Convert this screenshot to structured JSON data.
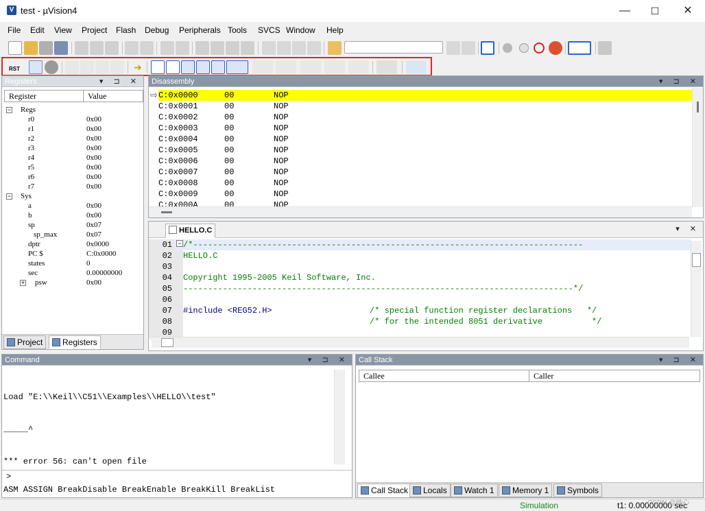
{
  "window": {
    "title": "test  - µVision4",
    "icon": "uv-icon"
  },
  "menu": [
    "File",
    "Edit",
    "View",
    "Project",
    "Flash",
    "Debug",
    "Peripherals",
    "Tools",
    "SVCS",
    "Window",
    "Help"
  ],
  "toolbar": {
    "rst_label": "RST"
  },
  "registers": {
    "title": "Registers",
    "col_register": "Register",
    "col_value": "Value",
    "rows": [
      {
        "name": "Regs",
        "value": "",
        "indent": 0,
        "tree": "minus"
      },
      {
        "name": "r0",
        "value": "0x00",
        "indent": 2
      },
      {
        "name": "r1",
        "value": "0x00",
        "indent": 2
      },
      {
        "name": "r2",
        "value": "0x00",
        "indent": 2
      },
      {
        "name": "r3",
        "value": "0x00",
        "indent": 2
      },
      {
        "name": "r4",
        "value": "0x00",
        "indent": 2
      },
      {
        "name": "r5",
        "value": "0x00",
        "indent": 2
      },
      {
        "name": "r6",
        "value": "0x00",
        "indent": 2
      },
      {
        "name": "r7",
        "value": "0x00",
        "indent": 2
      },
      {
        "name": "Sys",
        "value": "",
        "indent": 0,
        "tree": "minus"
      },
      {
        "name": "a",
        "value": "0x00",
        "indent": 2
      },
      {
        "name": "b",
        "value": "0x00",
        "indent": 2
      },
      {
        "name": "sp",
        "value": "0x07",
        "indent": 2
      },
      {
        "name": "sp_max",
        "value": "0x07",
        "indent": 3
      },
      {
        "name": "dptr",
        "value": "0x0000",
        "indent": 2
      },
      {
        "name": "PC  $",
        "value": "C:0x0000",
        "indent": 2
      },
      {
        "name": "states",
        "value": "0",
        "indent": 2
      },
      {
        "name": "sec",
        "value": "0.00000000",
        "indent": 2
      },
      {
        "name": "psw",
        "value": "0x00",
        "indent": 2,
        "tree": "plus"
      }
    ],
    "tabs": [
      "Project",
      "Registers"
    ]
  },
  "disassembly": {
    "title": "Disassembly",
    "rows": [
      {
        "addr": "C:0x0000",
        "op": "00",
        "mnem": "NOP"
      },
      {
        "addr": "C:0x0001",
        "op": "00",
        "mnem": "NOP"
      },
      {
        "addr": "C:0x0002",
        "op": "00",
        "mnem": "NOP"
      },
      {
        "addr": "C:0x0003",
        "op": "00",
        "mnem": "NOP"
      },
      {
        "addr": "C:0x0004",
        "op": "00",
        "mnem": "NOP"
      },
      {
        "addr": "C:0x0005",
        "op": "00",
        "mnem": "NOP"
      },
      {
        "addr": "C:0x0006",
        "op": "00",
        "mnem": "NOP"
      },
      {
        "addr": "C:0x0007",
        "op": "00",
        "mnem": "NOP"
      },
      {
        "addr": "C:0x0008",
        "op": "00",
        "mnem": "NOP"
      },
      {
        "addr": "C:0x0009",
        "op": "00",
        "mnem": "NOP"
      },
      {
        "addr": "C:0x000A",
        "op": "00",
        "mnem": "NOP"
      }
    ]
  },
  "editor": {
    "tab": "HELLO.C",
    "lines": [
      {
        "num": "01",
        "text": "/*-------------------------------------------------------------------------------",
        "kind": "comment"
      },
      {
        "num": "02",
        "text": "HELLO.C",
        "kind": "comment"
      },
      {
        "num": "03",
        "text": "",
        "kind": "comment"
      },
      {
        "num": "04",
        "text": "Copyright 1995-2005 Keil Software, Inc.",
        "kind": "comment"
      },
      {
        "num": "05",
        "text": "-------------------------------------------------------------------------------*/",
        "kind": "comment"
      },
      {
        "num": "06",
        "text": "",
        "kind": "code"
      },
      {
        "num": "07",
        "text": "#include <REG52.H>",
        "comment": "/* special function register declarations   */",
        "kind": "include"
      },
      {
        "num": "08",
        "text": "",
        "comment": "/* for the intended 8051 derivative          */",
        "kind": "include"
      },
      {
        "num": "09",
        "text": "",
        "kind": "code"
      }
    ]
  },
  "command": {
    "title": "Command",
    "output": [
      "Load \"E:\\\\Keil\\\\C51\\\\Examples\\\\HELLO\\\\test\"",
      "_____^",
      "*** error 56: can't open file"
    ],
    "prompt": ">",
    "hint": "ASM ASSIGN BreakDisable BreakEnable BreakKill BreakList"
  },
  "callstack": {
    "title": "Call Stack",
    "col_callee": "Callee",
    "col_caller": "Caller",
    "tabs": [
      "Call Stack",
      "Locals",
      "Watch 1",
      "Memory 1",
      "Symbols"
    ]
  },
  "status": {
    "mode": "Simulation",
    "time": "t1: 0.00000000 sec",
    "watermark": "CSDN @纳心"
  },
  "colors": {
    "highlight_row": "#ffff00",
    "comment": "#008000",
    "keyword": "#00008b",
    "red_box": "#e3242b"
  }
}
